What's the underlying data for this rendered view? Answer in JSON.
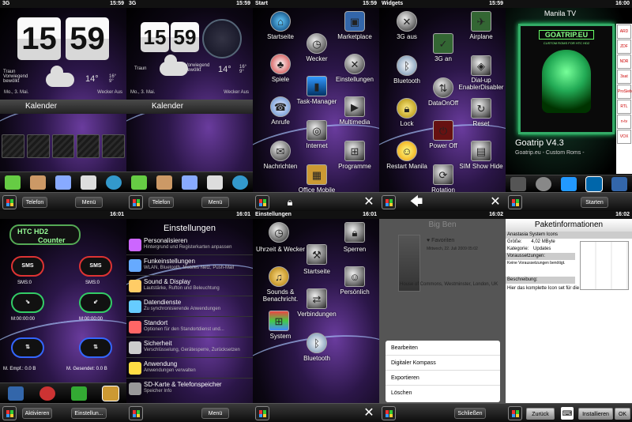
{
  "p1": {
    "carrier": "3G",
    "time": "15:59",
    "hour": "15",
    "min": "59",
    "city": "Traun",
    "cond": "Vorwiegend bewölkt",
    "temp": "14°",
    "hi": "16°",
    "lo": "9°",
    "date": "Mo., 3. Mai.",
    "alarm": "Wecker Aus",
    "cal": "Kalender",
    "sk1": "Telefon",
    "sk2": "Menü"
  },
  "p2": {
    "carrier": "3G",
    "time": "15:59",
    "hour": "15",
    "min": "59",
    "city": "Traun",
    "cond": "Vorwiegend bewölkt",
    "temp": "14°",
    "hi": "16°",
    "lo": "9°",
    "date": "Mo., 3. Mai.",
    "alarm": "Wecker Aus",
    "cal": "Kalender",
    "sk1": "Telefon",
    "sk2": "Menü"
  },
  "p3": {
    "title": "Start",
    "time": "15:59",
    "items": [
      "Startseite",
      "Marketplace",
      "Wecker",
      "Spiele",
      "Einstellungen",
      "Task-Manager",
      "Anrufe",
      "Multimedia",
      "Internet",
      "Nachrichten",
      "Programme",
      "Office Mobile"
    ]
  },
  "p4": {
    "title": "Widgets",
    "time": "15:59",
    "items": [
      "3G aus",
      "Airplane",
      "3G an",
      "Bluetooth",
      "Dial-up EnablerDisabler",
      "DataOnOff",
      "Lock",
      "Reset",
      "Power Off",
      "Restart Manila",
      "SIM Show Hide",
      "Rotation"
    ]
  },
  "p5": {
    "time": "16:00",
    "title": "Manila TV",
    "logo": "GOATRIP.EU",
    "logo_sub": "CUSTOM ROMS FOR HTC HD2",
    "name": "Goatrip V4.3",
    "sub": "Goatrip.eu - Custom Roms -",
    "sk": "Starten",
    "channels": [
      "ARD",
      "ZDF",
      "NDR",
      "3sat",
      "ProSieben",
      "RTL",
      "n-tv",
      "VOX"
    ]
  },
  "p6": {
    "time": "16:01",
    "logo1": "HTC HD2",
    "logo2": "Counter",
    "sms": "SMS",
    "sms_count": "SMS:0",
    "min1": "M:00:00:00",
    "min2": "M:00:00:00",
    "recv": "M. Empf.: 0.0 B",
    "sent": "M. Gesendet: 0.0 B",
    "sk1": "Aktivieren",
    "sk2": "Einstellun..."
  },
  "p7": {
    "time": "16:01",
    "title": "Einstellungen",
    "items": [
      [
        "Personalisieren",
        "Hintergrund und Registerkarten anpassen"
      ],
      [
        "Funkeinstellungen",
        "WLAN, Bluetooth, Mobiles Netz, Push-Mail"
      ],
      [
        "Sound & Display",
        "Lautstärke, Rufton und Beleuchtung"
      ],
      [
        "Datendienste",
        "Zu synchronisierende Anwendungen"
      ],
      [
        "Standort",
        "Optionen für den Standortdienst und..."
      ],
      [
        "Sicherheit",
        "Verschlüsselung, Gerätesperre, Zurücksetzen"
      ],
      [
        "Anwendung",
        "Anwendungen verwalten"
      ],
      [
        "SD-Karte & Telefonspeicher",
        "Speicher Info"
      ]
    ],
    "sk": "Menü"
  },
  "p8": {
    "title": "Einstellungen",
    "time": "16:01",
    "items": [
      "Uhrzeit & Wecker",
      "Sperren",
      "Startseite",
      "Sounds & Benachricht.",
      "Persönlich",
      "Verbindungen",
      "System",
      "Bluetooth"
    ]
  },
  "p9": {
    "time": "16:02",
    "place": "Big Ben",
    "fav": "Favoriten",
    "date": "Mittwoch, 22. Juli 2009 05:02",
    "addr": "House of Commons, Westminster, London, UK",
    "menu": [
      "Bearbeiten",
      "Digitaler Kompass",
      "Exportieren",
      "Löschen"
    ],
    "sk": "Schließen"
  },
  "p10": {
    "time": "16:02",
    "title": "Paketinformationen",
    "pkg": "Anastasia System Icons",
    "size_l": "Größe:",
    "size_v": "4,02 MByte",
    "cat_l": "Kategorie:",
    "cat_v": "Updates",
    "req": "Voraussetzungen:",
    "req_v": "Keine Voraussetzungen benötigt.",
    "desc": "Beschreibung:",
    "desc_v": "Hier das komplette Icon set für die 4.3",
    "sk1": "Zurück",
    "sk2": "Installieren",
    "sk3": "OK"
  }
}
